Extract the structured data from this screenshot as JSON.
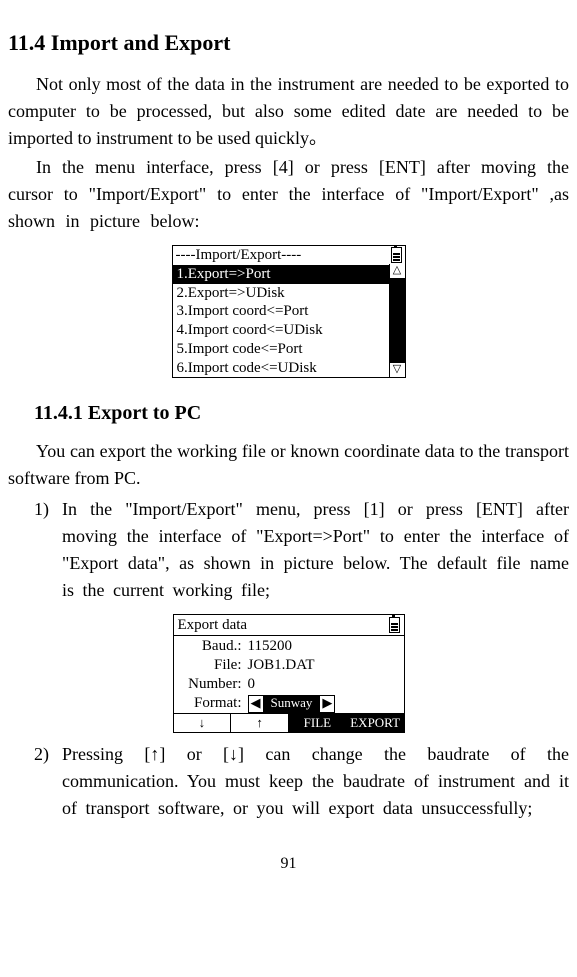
{
  "headings": {
    "section": "11.4 Import and Export",
    "subsection": "11.4.1 Export to PC"
  },
  "paragraphs": {
    "p1": "Not only most of the data in the instrument are needed to be exported to computer to be processed, but also some edited date are needed to be imported to instrument to be used quickly。",
    "p2": "In the menu interface, press [4] or press [ENT] after moving the cursor to \"Import/Export\" to enter the interface of \"Import/Export\" ,as shown in picture below:",
    "p3": "You can export the working file or known coordinate data to the transport software from PC."
  },
  "list": {
    "item1_num": "1)",
    "item1_txt": "In the \"Import/Export\" menu, press [1] or press [ENT] after moving the interface of \"Export=>Port\" to enter the interface of \"Export data\", as shown in picture below. The default file name is the current working file;",
    "item2_num": "2)",
    "item2_txt": "Pressing [↑] or [↓] can change the baudrate of the communication. You must keep the baudrate of instrument and it of transport software, or you will export data unsuccessfully;"
  },
  "lcd1": {
    "title": "----Import/Export----",
    "rows": {
      "r1": "1.Export=>Port",
      "r2": "2.Export=>UDisk",
      "r3": "3.Import coord<=Port",
      "r4": "4.Import coord<=UDisk",
      "r5": "5.Import code<=Port",
      "r6": "6.Import code<=UDisk"
    },
    "arrows": {
      "up": "△",
      "down": "▽"
    }
  },
  "lcd2": {
    "title": "Export data",
    "labels": {
      "baud": "Baud.:",
      "file": "File:",
      "number": "Number:",
      "format": "Format:"
    },
    "values": {
      "baud": "115200",
      "file": "JOB1.DAT",
      "number": "0",
      "format": "Sunway"
    },
    "tris": {
      "left": "◀",
      "right": "▶"
    },
    "footer": {
      "c1": "↓",
      "c2": "↑",
      "c3": "FILE",
      "c4": "EXPORT"
    }
  },
  "pagenum": "91"
}
